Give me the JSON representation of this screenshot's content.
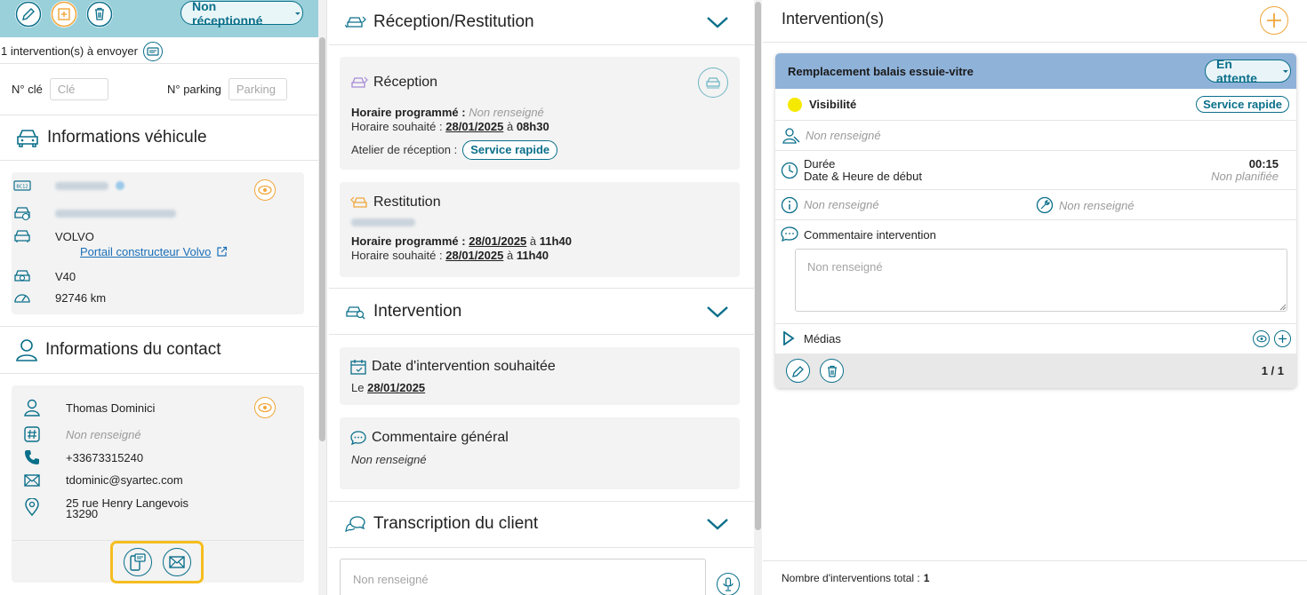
{
  "left": {
    "status": "Non réceptionné",
    "send_text": "1 intervention(s) à envoyer",
    "key_label": "N° clé",
    "key_placeholder": "Clé",
    "parking_label": "N° parking",
    "parking_placeholder": "Parking",
    "vehicle_title": "Informations véhicule",
    "vehicle": {
      "brand": "VOLVO",
      "portal_link": "Portail constructeur Volvo",
      "model": "V40",
      "mileage": "92746 km"
    },
    "contact_title": "Informations du contact",
    "contact": {
      "name": "Thomas Dominici",
      "id_value": "Non renseigné",
      "phone": "+33673315240",
      "email": "tdominic@syartec.com",
      "address_line1": "25 rue Henry Langevois",
      "address_line2": "13290"
    }
  },
  "mid": {
    "reception_section_title": "Réception/Restitution",
    "reception": {
      "title": "Réception",
      "scheduled_label": "Horaire programmé :",
      "scheduled_value": "Non renseigné",
      "wished_label": "Horaire souhaité :",
      "wished_date": "28/01/2025",
      "wished_at": "à",
      "wished_time": "08h30",
      "workshop_label": "Atelier de réception :",
      "workshop_value": "Service rapide"
    },
    "restitution": {
      "title": "Restitution",
      "scheduled_label": "Horaire programmé :",
      "scheduled_date": "28/01/2025",
      "scheduled_at": "à",
      "scheduled_time": "11h40",
      "wished_label": "Horaire souhaité :",
      "wished_date": "28/01/2025",
      "wished_at": "à",
      "wished_time": "11h40"
    },
    "intervention_section_title": "Intervention",
    "wished_date_card": {
      "title": "Date d'intervention souhaitée",
      "prefix": "Le",
      "date": "28/01/2025"
    },
    "comment_card": {
      "title": "Commentaire général",
      "value": "Non renseigné"
    },
    "transcription_section_title": "Transcription du client",
    "transcription_placeholder": "Non renseigné"
  },
  "right": {
    "title": "Intervention(s)",
    "card": {
      "title": "Remplacement balais essuie-vitre",
      "status": "En attente",
      "category": "Visibilité",
      "category_color": "#f5e900",
      "service_tag": "Service rapide",
      "technician": "Non renseigné",
      "duration_label": "Durée",
      "duration_value": "00:15",
      "start_label": "Date & Heure de début",
      "start_value": "Non planifiée",
      "info_value": "Non renseigné",
      "tool_value": "Non renseigné",
      "comment_label": "Commentaire intervention",
      "comment_placeholder": "Non renseigné",
      "medias_label": "Médias",
      "pagination": "1 / 1"
    },
    "total_label": "Nombre d'interventions total :",
    "total_value": "1"
  },
  "colors": {
    "accent": "#0a6f8a",
    "orange": "#f0a63a",
    "topbar": "#9ad0da",
    "card_header": "#8fb2d9",
    "highlight": "#f5bd1f"
  }
}
